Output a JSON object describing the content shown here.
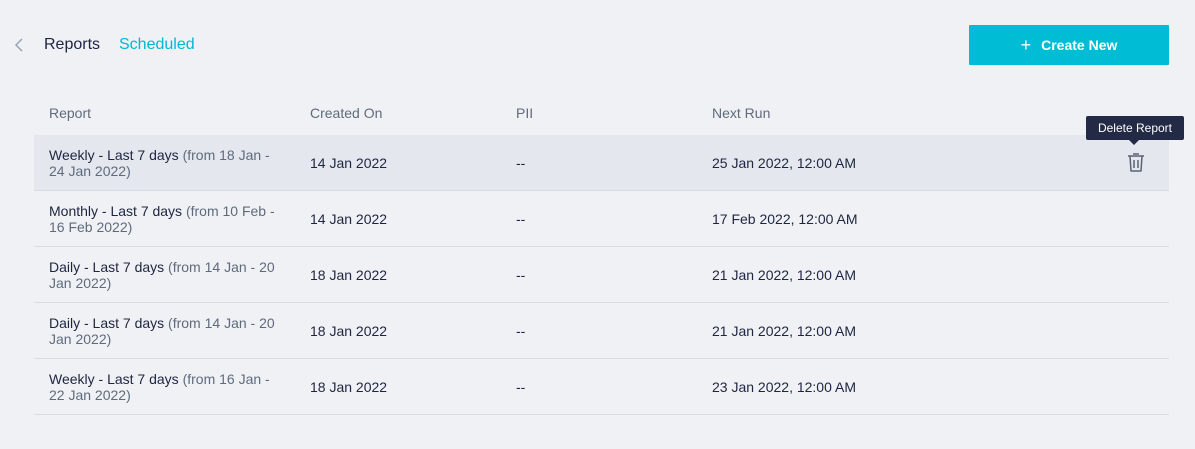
{
  "breadcrumb": {
    "parent": "Reports",
    "current": "Scheduled"
  },
  "actions": {
    "create_label": "Create New",
    "create_icon": "plus-icon"
  },
  "table": {
    "columns": [
      "Report",
      "Created On",
      "PII",
      "Next Run"
    ],
    "rows": [
      {
        "name": "Weekly - Last 7 days",
        "range": " (from 18 Jan - 24 Jan 2022)",
        "created": "14 Jan 2022",
        "pii": "--",
        "next_run": "25 Jan 2022, 12:00 AM"
      },
      {
        "name": "Monthly - Last 7 days",
        "range": " (from 10 Feb - 16 Feb 2022)",
        "created": "14 Jan 2022",
        "pii": "--",
        "next_run": "17 Feb 2022, 12:00 AM"
      },
      {
        "name": "Daily - Last 7 days",
        "range": " (from 14 Jan - 20 Jan 2022)",
        "created": "18 Jan 2022",
        "pii": "--",
        "next_run": "21 Jan 2022, 12:00 AM"
      },
      {
        "name": "Daily - Last 7 days",
        "range": " (from 14 Jan - 20 Jan 2022)",
        "created": "18 Jan 2022",
        "pii": "--",
        "next_run": "21 Jan 2022, 12:00 AM"
      },
      {
        "name": "Weekly - Last 7 days",
        "range": " (from 16 Jan - 22 Jan 2022)",
        "created": "18 Jan 2022",
        "pii": "--",
        "next_run": "23 Jan 2022, 12:00 AM"
      }
    ]
  },
  "tooltip": {
    "text": "Delete Report"
  },
  "colors": {
    "accent": "#00bcd4",
    "text": "#1e2540",
    "muted": "#5f6b7c",
    "background": "#f0f1f5",
    "tooltip_bg": "#222a45"
  }
}
